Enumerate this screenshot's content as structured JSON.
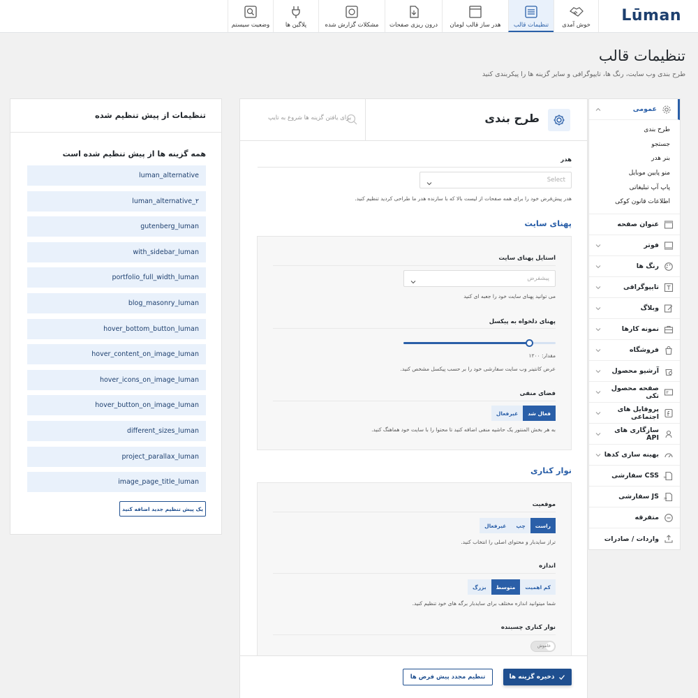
{
  "brand": {
    "logo_text": "Lūman"
  },
  "tabs": [
    {
      "label": "خوش آمدی",
      "icon": "handshake-icon"
    },
    {
      "label": "تنظیمات قالب",
      "icon": "settings-panel-icon",
      "active": true
    },
    {
      "label": "هدر ساز قالب لومان",
      "icon": "header-builder-icon"
    },
    {
      "label": "درون ریزی صفحات",
      "icon": "import-pages-icon"
    },
    {
      "label": "مشکلات گزارش شده",
      "icon": "bug-report-icon"
    },
    {
      "label": "پلاگین ها",
      "icon": "plugin-icon"
    },
    {
      "label": "وضعیت سیستم",
      "icon": "system-status-icon"
    }
  ],
  "page": {
    "title": "تنظیمات قالب",
    "description": "طرح بندی وب سایت، رنگ ها، تایپوگرافی و سایر گزینه ها را پیکربندی کنید"
  },
  "nav": {
    "active_item": "عمومی",
    "sub_items": [
      "طرح بندی",
      "جستجو",
      "بنر هدر",
      "منو پایین موبایل",
      "پاپ آپ تبلیغاتی",
      "اطلاعات قانون کوکی"
    ],
    "items": [
      {
        "label": "عنوان صفحه",
        "icon": "page-title-icon"
      },
      {
        "label": "فوتر",
        "icon": "footer-icon"
      },
      {
        "label": "رنگ ها",
        "icon": "palette-icon"
      },
      {
        "label": "تایپوگرافی",
        "icon": "typography-icon"
      },
      {
        "label": "وبلاگ",
        "icon": "blog-icon"
      },
      {
        "label": "نمونه کارها",
        "icon": "portfolio-icon"
      },
      {
        "label": "فروشگاه",
        "icon": "shop-icon"
      },
      {
        "label": "آرشیو محصول",
        "icon": "product-archive-icon"
      },
      {
        "label": "صفحه محصول تکی",
        "icon": "single-product-icon"
      },
      {
        "label": "پروفایل های اجتماعی",
        "icon": "social-icon"
      },
      {
        "label": "سازگاری های API",
        "icon": "api-icon"
      },
      {
        "label": "بهینه سازی کدها",
        "icon": "speed-icon"
      },
      {
        "label": "CSS سفارشی",
        "icon": "css-icon"
      },
      {
        "label": "JS سفارشی",
        "icon": "js-icon"
      },
      {
        "label": "متفرقه",
        "icon": "misc-icon"
      },
      {
        "label": "واردات / صادرات",
        "icon": "import-export-icon"
      }
    ]
  },
  "main": {
    "title": "طرح بندی",
    "search_placeholder": "برای یافتن گزینه ها شروع به تایپ",
    "header_field": {
      "label": "هدر",
      "value": "Select",
      "help": "هدر پیش‌فرض خود را برای همه صفحات از لیست بالا که با سازنده هدر ما طراحی کردید تنظیم کنید."
    },
    "site_width": {
      "section_title": "پهنای سایت",
      "style_label": "استایل پهنای سایت",
      "style_value": "پیشفرض",
      "style_help": "می توانید پهنای سایت خود را جعبه ای کنید",
      "custom_label": "پهنای دلخواه به پیکسل",
      "slider_fraction": 0.83,
      "value_text": "مقدار: ۱۲۰۰",
      "custom_help": "عرض کانتینر وب سایت سفارشی خود را بر حسب پیکسل مشخص کنید.",
      "negative_label": "فضای منفی",
      "negative_options": [
        "فعال شد",
        "غیرفعال"
      ],
      "negative_selected": "فعال شد",
      "negative_help": "به هر بخش المنتور یک حاشیه منفی اضافه کنید تا محتوا را با سایت خود هماهنگ کنید."
    },
    "sidebar": {
      "section_title": "نوار کناری",
      "position_label": "موقعیت",
      "position_options": [
        "راست",
        "چپ",
        "غیرفعال"
      ],
      "position_selected": "راست",
      "position_help": "تراز ساید‌بار و محتوای اصلی را انتخاب کنید.",
      "size_label": "اندازه",
      "size_options": [
        "کم اهمیت",
        "متوسط",
        "بزرگ"
      ],
      "size_selected": "متوسط",
      "size_help": "شما میتوانید اندازه مختلف برای ساید‌بار برگه های خود تنظیم کنید.",
      "sticky_label": "نوار کناری چسبنده",
      "sticky_state": "خاموش"
    }
  },
  "actions": {
    "save_label": "ذخیره گزینه ها",
    "reset_label": "تنظیم مجدد پیش فرض ها"
  },
  "presets": {
    "title": "تنظیمات از پیش تنظیم شده",
    "subtitle": "همه گزینه ها از پیش تنظیم شده است",
    "items": [
      "luman_alternative",
      "luman_alternative_۲",
      "gutenberg_luman",
      "with_sidebar_luman",
      "portfolio_full_width_luman",
      "blog_masonry_luman",
      "hover_bottom_button_luman",
      "hover_content_on_image_luman",
      "hover_icons_on_image_luman",
      "hover_button_on_image_luman",
      "different_sizes_luman",
      "project_parallax_luman",
      "image_page_title_luman"
    ],
    "add_button": "یک پیش تنظیم جدید اضافه کنید"
  },
  "colors": {
    "accent": "#2a5fa8",
    "accent_dark": "#1f4f8f",
    "light_accent": "#e9f1fb"
  }
}
